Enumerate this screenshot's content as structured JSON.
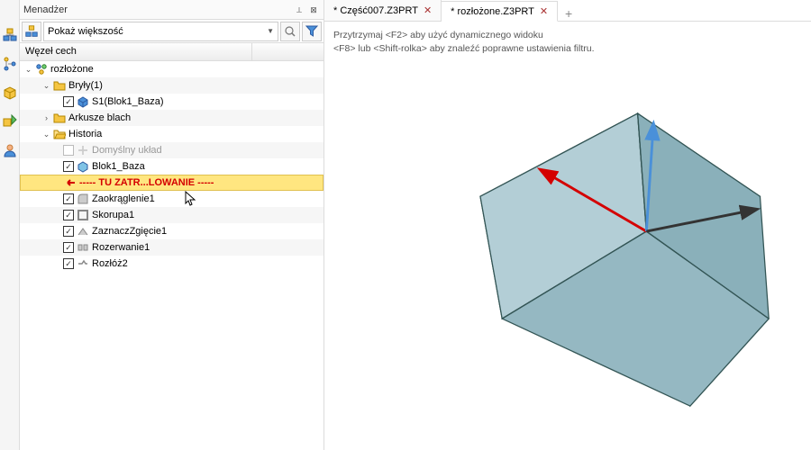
{
  "panel": {
    "title": "Menadżer",
    "filter_combo": "Pokaż większość",
    "column1": "Węzeł cech"
  },
  "tree": {
    "root": "rozłożone",
    "bodies_label": "Bryły(1)",
    "body_s1": "S1(Blok1_Baza)",
    "sheets": "Arkusze blach",
    "history": "Historia",
    "default_layout": "Domyślny układ",
    "blok1": "Blok1_Baza",
    "rollback": "----- TU ZATR...LOWANIE -----",
    "fillet": "Zaokrąglenie1",
    "shell": "Skorupa1",
    "markbend": "ZaznaczZgięcie1",
    "rip": "Rozerwanie1",
    "unfold": "Rozłóż2"
  },
  "tabs": {
    "tab1": "* Część007.Z3PRT",
    "tab2": "* rozłożone.Z3PRT"
  },
  "help": {
    "line1": "Przytrzymaj <F2> aby użyć dynamicznego widoku",
    "line2": "<F8> lub <Shift-rolka> aby znaleźć poprawne ustawienia filtru."
  }
}
